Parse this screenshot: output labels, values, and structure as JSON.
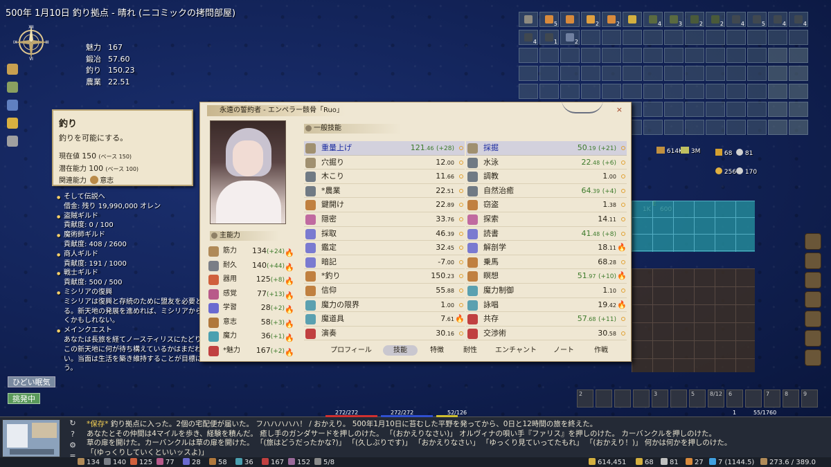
{
  "title": "500年 1月10日 釣り拠点 - 晴れ (ニコミックの拷問部屋)",
  "compass": {
    "n": "XII",
    "e": "III",
    "s": "VI",
    "w": "IX"
  },
  "side_stats": [
    {
      "k": "魅力",
      "v": "167"
    },
    {
      "k": "鍛冶",
      "v": "57.60"
    },
    {
      "k": "釣り",
      "v": "150.23"
    },
    {
      "k": "農業",
      "v": "22.51"
    }
  ],
  "tooltip": {
    "title": "釣り",
    "desc": "釣りを可能にする。",
    "current_label": "現在値",
    "current": "150",
    "current_base": "(ベース 150)",
    "potential_label": "潜在能力",
    "potential": "100",
    "potential_base": "(ベース 100)",
    "related_label": "関連能力",
    "related": "意志"
  },
  "quests": [
    {
      "t": "そして伝説へ",
      "d": [
        "借金: 残り 19,990,000 オレン"
      ]
    },
    {
      "t": "盗賊ギルド",
      "d": [
        "貢献度: 0 / 100"
      ]
    },
    {
      "t": "魔術師ギルド",
      "d": [
        "貢献度: 408 / 2600"
      ]
    },
    {
      "t": "商人ギルド",
      "d": [
        "貢献度: 191 / 1000"
      ]
    },
    {
      "t": "戦士ギルド",
      "d": [
        "貢献度: 500 / 500"
      ]
    },
    {
      "t": "ミシリアの復興",
      "d": [
        "ミシリアは復興と存続のために盟友を必要と",
        "る。新天地の発展を進めれば、ミシリアから",
        "くかもしれない。"
      ]
    },
    {
      "t": "メインクエスト",
      "d": [
        "あなたは長旅を経てノースティリスにたどり",
        "この新天地に何が待ち構えているかはまだわ",
        "い。当面は生活を築き維持することが目標に",
        "う。"
      ]
    }
  ],
  "status": [
    "ひどい眠気",
    "挑発中"
  ],
  "inventory": {
    "counts": [
      "",
      "5",
      "",
      "2",
      "2",
      "",
      "4",
      "3",
      "2",
      "2",
      "4",
      "5",
      "4",
      "4",
      "4",
      "1",
      "2"
    ],
    "colors": [
      "#8e8a80",
      "#d88a3c",
      "#d88a3c",
      "#e0a040",
      "#d88a3c",
      "#d4b040",
      "#5a6a40",
      "#5a6a40",
      "#4a5a3a",
      "#4a5a3a",
      "#404850",
      "#404850",
      "#404850",
      "#404850",
      "#404850",
      "#404850",
      "#7080a0"
    ]
  },
  "currency": {
    "a": "614K",
    "b": "3M",
    "c": "68",
    "d": "81",
    "e": "256",
    "f": "170",
    "g": "1K",
    "h": "600",
    "i": "E"
  },
  "window": {
    "header": "永遠の誓約者 - エンペラー骸骨「Ruo」",
    "close": "×",
    "main_attr_header": "主能力",
    "general_skill_header": "一般技能",
    "attributes": [
      {
        "n": "筋力",
        "v": "134",
        "b": "(+24)",
        "c": "#b08a58"
      },
      {
        "n": "耐久",
        "v": "140",
        "b": "(+44)",
        "c": "#7a7e86"
      },
      {
        "n": "器用",
        "v": "125",
        "b": "(+8)",
        "c": "#d0603c"
      },
      {
        "n": "感覚",
        "v": "77",
        "b": "(+13)",
        "c": "#b85a8a"
      },
      {
        "n": "学習",
        "v": "28",
        "b": "(+2)",
        "c": "#6a6ad0"
      },
      {
        "n": "意志",
        "v": "58",
        "b": "(+3)",
        "c": "#b0783c"
      },
      {
        "n": "魔力",
        "v": "36",
        "b": "(+1)",
        "c": "#4aa0b0"
      },
      {
        "n": "*魅力",
        "v": "167",
        "b": "(+2)",
        "c": "#c04040"
      }
    ],
    "skills_left": [
      {
        "n": "重量上げ",
        "v": "121",
        "d": ".46",
        "b": "(+28)",
        "c": "#a09070",
        "sel": true
      },
      {
        "n": "穴掘り",
        "v": "12",
        "d": ".00",
        "c": "#a09070"
      },
      {
        "n": "木こり",
        "v": "11",
        "d": ".66",
        "c": "#707a84"
      },
      {
        "n": "*農業",
        "v": "22",
        "d": ".51",
        "c": "#707a84"
      },
      {
        "n": "鍵開け",
        "v": "22",
        "d": ".89",
        "c": "#c08040"
      },
      {
        "n": "隠密",
        "v": "33",
        "d": ".76",
        "c": "#c06aa0"
      },
      {
        "n": "採取",
        "v": "46",
        "d": ".39",
        "c": "#7a7ad0"
      },
      {
        "n": "鑑定",
        "v": "32",
        "d": ".45",
        "c": "#7a7ad0"
      },
      {
        "n": "暗記",
        "v": "-7",
        "d": ".00",
        "c": "#7a7ad0"
      },
      {
        "n": "*釣り",
        "v": "150",
        "d": ".23",
        "c": "#c08040"
      },
      {
        "n": "信仰",
        "v": "55",
        "d": ".88",
        "c": "#c08040"
      },
      {
        "n": "魔力の限界",
        "v": "1",
        "d": ".00",
        "c": "#5aa0b0"
      },
      {
        "n": "魔道具",
        "v": "7",
        "d": ".61",
        "c": "#5aa0b0",
        "fl": true
      },
      {
        "n": "演奏",
        "v": "30",
        "d": ".16",
        "c": "#c04040"
      }
    ],
    "skills_right": [
      {
        "n": "採掘",
        "v": "50",
        "d": ".19",
        "b": "(+21)",
        "c": "#a09070",
        "sel": true
      },
      {
        "n": "水泳",
        "v": "22",
        "d": ".48",
        "b": "(+6)",
        "c": "#707a84"
      },
      {
        "n": "調教",
        "v": "1",
        "d": ".00",
        "c": "#707a84"
      },
      {
        "n": "自然治癒",
        "v": "64",
        "d": ".39",
        "b": "(+4)",
        "c": "#707a84"
      },
      {
        "n": "窃盗",
        "v": "1",
        "d": ".38",
        "c": "#c08040"
      },
      {
        "n": "探索",
        "v": "14",
        "d": ".11",
        "c": "#c06aa0"
      },
      {
        "n": "読書",
        "v": "41",
        "d": ".48",
        "b": "(+8)",
        "c": "#7a7ad0"
      },
      {
        "n": "解剖学",
        "v": "18",
        "d": ".11",
        "c": "#7a7ad0",
        "fl": true
      },
      {
        "n": "乗馬",
        "v": "68",
        "d": ".28",
        "c": "#c08040"
      },
      {
        "n": "瞑想",
        "v": "51",
        "d": ".97",
        "b": "(+10)",
        "c": "#c08040",
        "fl": true
      },
      {
        "n": "魔力制御",
        "v": "1",
        "d": ".10",
        "c": "#5aa0b0"
      },
      {
        "n": "詠唱",
        "v": "19",
        "d": ".42",
        "c": "#5aa0b0",
        "fl": true
      },
      {
        "n": "共存",
        "v": "57",
        "d": ".68",
        "b": "(+11)",
        "c": "#c04040"
      },
      {
        "n": "交渉術",
        "v": "30",
        "d": ".58",
        "c": "#c04040"
      }
    ],
    "tabs": [
      {
        "l": "プロフィール"
      },
      {
        "l": "技能",
        "on": true
      },
      {
        "l": "特徴"
      },
      {
        "l": "耐性"
      },
      {
        "l": "エンチャント"
      },
      {
        "l": "ノート"
      },
      {
        "l": "作戦"
      }
    ]
  },
  "bars": {
    "hp": "272/272",
    "mp": "272/272",
    "sp": "52/126",
    "exp": "55/1760",
    "lv": "1"
  },
  "messages": [
    {
      "hl": "*保存* ",
      "t": "釣り拠点に入った。2個の宅配便が届いた。 フハハハハハ！ / おかえり。 500年1月10日に苔むした平野を発ってから、0日と12時間の旅を終えた。"
    },
    {
      "t": "あなたとその仲間は4マイルを歩き、経験を積んだ。 癒し手のガンダサードを押しのけた。 「(おかえりなさい)」 オルヴィナの唄い手『ファリス』を押しのけた。 カーバンクルを押しのけた。"
    },
    {
      "t": "草の扉を開けた。カーバンクルは草の扉を開けた。 「(旅はどうだったかな?)」 「(久しぶりです)」 「おかえりなさい」 「ゆっくり見ていってたもれ」 「(おかえり！)」 何かは何かを押しのけた。"
    },
    {
      "t": "「(ゆっくりしていくといいッスよ)」"
    }
  ],
  "bottom_stats": [
    {
      "v": "134",
      "c": "#b08a58"
    },
    {
      "v": "140",
      "c": "#7a7e86"
    },
    {
      "v": "125",
      "c": "#d0603c"
    },
    {
      "v": "77",
      "c": "#b85a8a"
    },
    {
      "v": "28",
      "c": "#6a6ad0"
    },
    {
      "v": "58",
      "c": "#b0783c"
    },
    {
      "v": "36",
      "c": "#4aa0b0"
    },
    {
      "v": "167",
      "c": "#c04040"
    },
    {
      "v": "152",
      "c": "#9a6a9a"
    },
    {
      "v": "5/8",
      "c": "#8a8a8a"
    }
  ],
  "bottom_right": [
    {
      "v": "614,451",
      "c": "#d4b040"
    },
    {
      "v": "68",
      "c": "#d4b040"
    },
    {
      "v": "81",
      "c": "#c0c0c0"
    },
    {
      "v": "27",
      "c": "#d88a3c"
    },
    {
      "v": "7 (1144.5)",
      "c": "#40a0e0"
    },
    {
      "v": "273.6 / 389.0",
      "c": "#b08a58"
    }
  ],
  "hotbar": {
    "labels": [
      "2",
      "",
      "",
      "",
      "3",
      "",
      "5",
      "8/12",
      "6",
      "",
      "7",
      "8",
      "9"
    ]
  }
}
